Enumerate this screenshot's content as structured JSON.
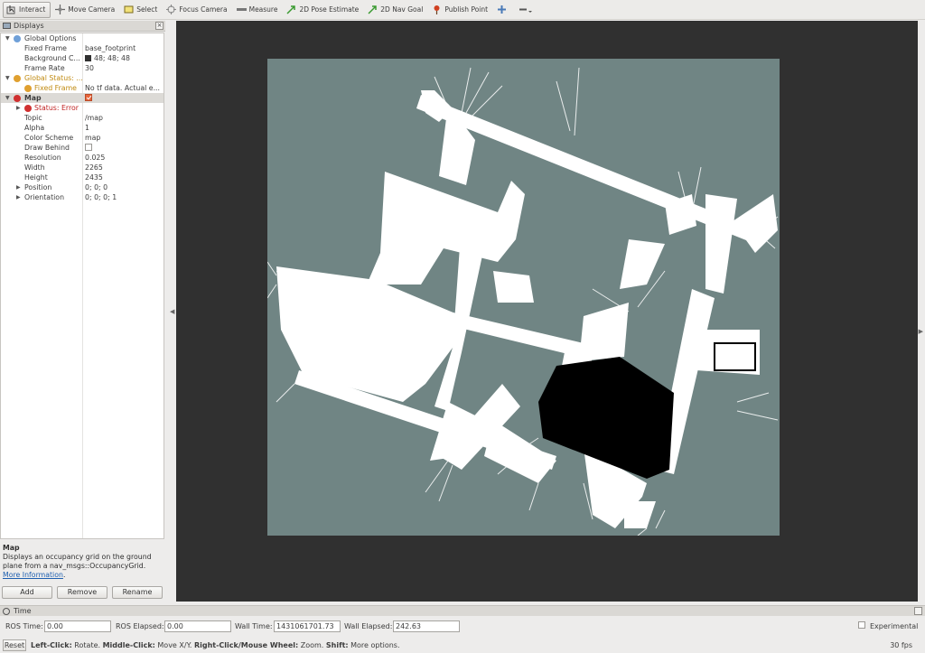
{
  "toolbar": {
    "interact": "Interact",
    "move_camera": "Move Camera",
    "select": "Select",
    "focus_camera": "Focus Camera",
    "measure": "Measure",
    "pose_estimate": "2D Pose Estimate",
    "nav_goal": "2D Nav Goal",
    "publish_point": "Publish Point"
  },
  "displays": {
    "title": "Displays",
    "close": "×",
    "global_options": {
      "label": "Global Options",
      "fixed_frame_key": "Fixed Frame",
      "fixed_frame_val": "base_footprint",
      "bg_key": "Background C...",
      "bg_val": "48; 48; 48",
      "fps_key": "Frame Rate",
      "fps_val": "30"
    },
    "global_status": {
      "label": "Global Status: ...",
      "ff_key": "Fixed Frame",
      "ff_val": "No tf data.  Actual e..."
    },
    "map": {
      "label": "Map",
      "status": "Status: Error",
      "topic_key": "Topic",
      "topic_val": "/map",
      "alpha_key": "Alpha",
      "alpha_val": "1",
      "scheme_key": "Color Scheme",
      "scheme_val": "map",
      "draw_key": "Draw Behind",
      "res_key": "Resolution",
      "res_val": "0.025",
      "width_key": "Width",
      "width_val": "2265",
      "height_key": "Height",
      "height_val": "2435",
      "pos_key": "Position",
      "pos_val": "0; 0; 0",
      "orient_key": "Orientation",
      "orient_val": "0; 0; 0; 1"
    },
    "description": {
      "title": "Map",
      "text": "Displays an occupancy grid on the ground plane from a nav_msgs::OccupancyGrid.",
      "link": "More Information",
      "end": "."
    },
    "buttons": {
      "add": "Add",
      "remove": "Remove",
      "rename": "Rename"
    }
  },
  "time": {
    "title": "Time",
    "ros_time_label": "ROS Time:",
    "ros_time": "0.00",
    "ros_elapsed_label": "ROS Elapsed:",
    "ros_elapsed": "0.00",
    "wall_time_label": "Wall Time:",
    "wall_time": "1431061701.73",
    "wall_elapsed_label": "Wall Elapsed:",
    "wall_elapsed": "242.63",
    "experimental": "Experimental"
  },
  "status": {
    "reset": "Reset",
    "left_click": "Left-Click:",
    "left_action": " Rotate. ",
    "middle_click": "Middle-Click:",
    "middle_action": " Move X/Y. ",
    "right_click": "Right-Click/Mouse Wheel:",
    "right_action": " Zoom. ",
    "shift": "Shift:",
    "shift_action": " More options.",
    "fps": "30 fps"
  },
  "colors": {
    "viewport_bg": "#303030",
    "map_unknown": "#708584",
    "map_free": "#ffffff",
    "map_occupied": "#000000",
    "warning": "#e0a030",
    "error": "#d03030"
  }
}
